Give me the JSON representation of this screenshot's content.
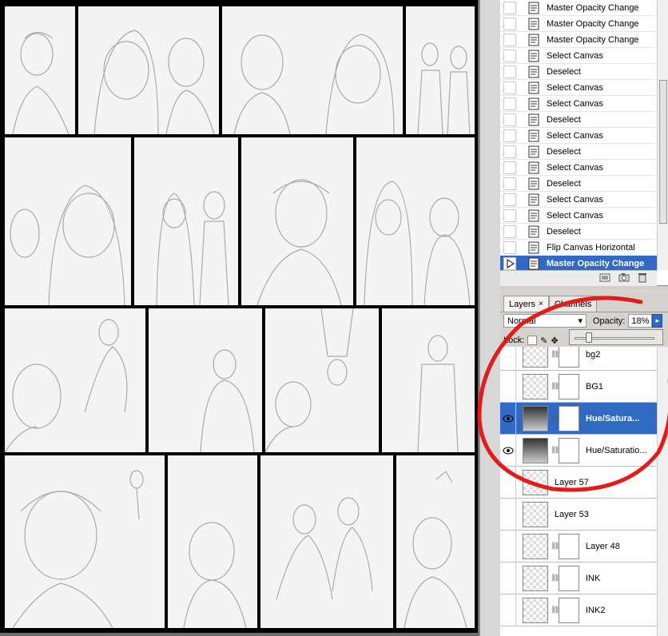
{
  "history": {
    "items": [
      {
        "label": "Master Opacity Change",
        "active": false
      },
      {
        "label": "Master Opacity Change",
        "active": false
      },
      {
        "label": "Master Opacity Change",
        "active": false
      },
      {
        "label": "Select Canvas",
        "active": false
      },
      {
        "label": "Deselect",
        "active": false
      },
      {
        "label": "Select Canvas",
        "active": false
      },
      {
        "label": "Select Canvas",
        "active": false
      },
      {
        "label": "Deselect",
        "active": false
      },
      {
        "label": "Select Canvas",
        "active": false
      },
      {
        "label": "Deselect",
        "active": false
      },
      {
        "label": "Select Canvas",
        "active": false
      },
      {
        "label": "Deselect",
        "active": false
      },
      {
        "label": "Select Canvas",
        "active": false
      },
      {
        "label": "Select Canvas",
        "active": false
      },
      {
        "label": "Deselect",
        "active": false
      },
      {
        "label": "Flip Canvas Horizontal",
        "active": false
      },
      {
        "label": "Master Opacity Change",
        "active": true
      }
    ]
  },
  "layers": {
    "tabs": [
      {
        "label": "Layers",
        "close": "×",
        "active": true
      },
      {
        "label": "Channels",
        "close": "",
        "active": false
      }
    ],
    "blend_mode": "Normal",
    "opacity_label": "Opacity:",
    "opacity_value": "18%",
    "lock_label": "Lock:",
    "items": [
      {
        "name": "bg2",
        "visible": false,
        "mask": true,
        "adjustment": false,
        "selected": false
      },
      {
        "name": "BG1",
        "visible": false,
        "mask": true,
        "adjustment": false,
        "selected": false
      },
      {
        "name": "Hue/Satura...",
        "visible": true,
        "mask": true,
        "adjustment": true,
        "selected": true
      },
      {
        "name": "Hue/Saturatio...",
        "visible": true,
        "mask": true,
        "adjustment": true,
        "selected": false
      },
      {
        "name": "Layer 57",
        "visible": false,
        "mask": false,
        "adjustment": false,
        "selected": false
      },
      {
        "name": "Layer 53",
        "visible": false,
        "mask": false,
        "adjustment": false,
        "selected": false
      },
      {
        "name": "Layer 48",
        "visible": false,
        "mask": true,
        "adjustment": false,
        "selected": false
      },
      {
        "name": "INK",
        "visible": false,
        "mask": true,
        "adjustment": false,
        "selected": false
      },
      {
        "name": "INK2",
        "visible": false,
        "mask": true,
        "adjustment": false,
        "selected": false
      }
    ]
  },
  "colors": {
    "selection": "#316ac5",
    "annotation": "#e31b1b"
  }
}
